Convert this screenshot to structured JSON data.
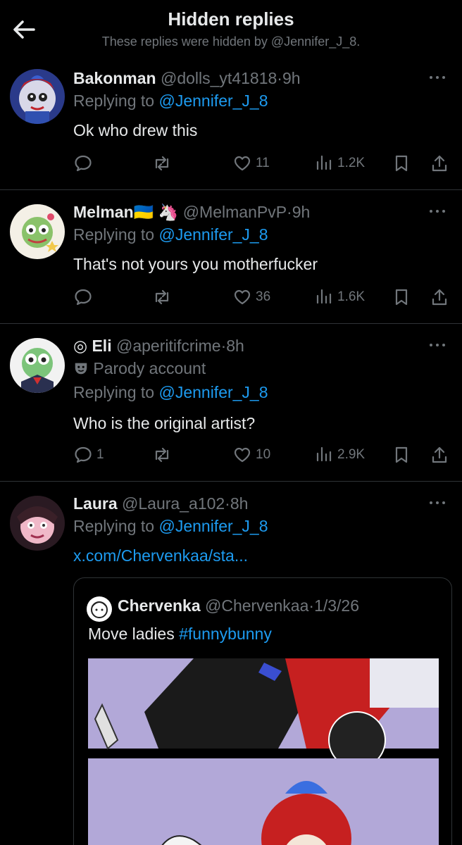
{
  "header": {
    "title": "Hidden replies",
    "subtitle": "These replies were hidden by @Jennifer_J_8."
  },
  "replies": [
    {
      "name": "Bakonman",
      "handle": "@dolls_yt41818",
      "dot": "·",
      "time": "9h",
      "replying_prefix": "Replying to",
      "replying_to": "@Jennifer_J_8",
      "text": "Ok who drew this",
      "replies_count": "",
      "likes": "11",
      "views": "1.2K"
    },
    {
      "name": "Melman",
      "name_emoji": "🇺🇦 🦄",
      "handle": "@MelmanPvP",
      "dot": "·",
      "time": "9h",
      "replying_prefix": "Replying to",
      "replying_to": "@Jennifer_J_8",
      "text": "That's not yours you motherfucker",
      "replies_count": "",
      "likes": "36",
      "views": "1.6K"
    },
    {
      "name_prefix": "◎",
      "name": "Eli",
      "handle": "@aperitifcrime",
      "dot": "·",
      "time": "8h",
      "parody_label": "Parody account",
      "replying_prefix": "Replying to",
      "replying_to": "@Jennifer_J_8",
      "text": "Who is the original artist?",
      "replies_count": "1",
      "likes": "10",
      "views": "2.9K"
    },
    {
      "name": "Laura",
      "handle": "@Laura_a102",
      "dot": "·",
      "time": "8h",
      "replying_prefix": "Replying to",
      "replying_to": "@Jennifer_J_8",
      "link_text": "x.com/Chervenkaa/sta..."
    }
  ],
  "quote": {
    "name": "Chervenka",
    "handle": "@Chervenkaa",
    "dot": "·",
    "date": "1/3/26",
    "text_plain": "Move ladies ",
    "hashtag": "#funnybunny"
  },
  "colors": {
    "background": "#000000",
    "text": "#e7e9ea",
    "muted": "#71767b",
    "link": "#1d9bf0",
    "divider": "#2f3336"
  }
}
